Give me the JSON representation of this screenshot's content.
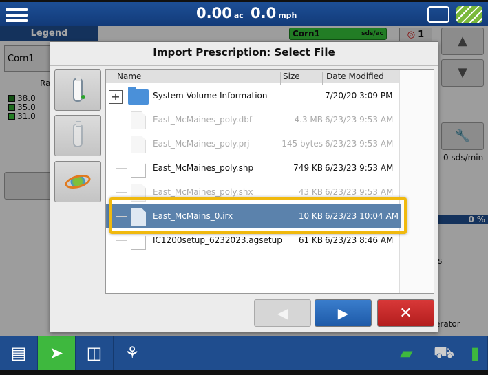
{
  "topbar": {
    "area_value": "0.00",
    "area_unit": "ac",
    "speed_value": "0.0",
    "speed_unit": "mph"
  },
  "work": {
    "legend_tab": "Legend",
    "legend_product": "Corn1",
    "rate_label": "Ra",
    "legend_rows": [
      {
        "value": "38.0",
        "color": "#1e7d1e"
      },
      {
        "value": "35.0",
        "color": "#2ea52e"
      },
      {
        "value": "31.0",
        "color": "#3ac23a"
      }
    ],
    "product_tab_name": "Corn1",
    "product_tab_unit": "sds/ac",
    "counter": "1",
    "rate_value": "0 sds/min",
    "progress": "0 %",
    "side_text_1": "s",
    "side_text_2": "erator"
  },
  "dialog": {
    "title": "Import Prescription: Select File",
    "columns": {
      "name": "Name",
      "size": "Size",
      "date": "Date Modified"
    },
    "sources": [
      {
        "icon": "usb-drive-icon",
        "active": true
      },
      {
        "icon": "usb-drive-icon",
        "active": false
      },
      {
        "icon": "cloud-sync-icon",
        "active": true
      }
    ],
    "rows": [
      {
        "name": "System Volume Information",
        "size": "",
        "date": "7/20/20 3:09 PM",
        "type": "folder",
        "state": "normal"
      },
      {
        "name": "East_McMaines_poly.dbf",
        "size": "4.3 MB",
        "date": "6/23/23 9:53 AM",
        "type": "file",
        "state": "disabled"
      },
      {
        "name": "East_McMaines_poly.prj",
        "size": "145 bytes",
        "date": "6/23/23 9:53 AM",
        "type": "file",
        "state": "disabled"
      },
      {
        "name": "East_McMaines_poly.shp",
        "size": "749 KB",
        "date": "6/23/23 9:53 AM",
        "type": "file",
        "state": "normal"
      },
      {
        "name": "East_McMaines_poly.shx",
        "size": "43 KB",
        "date": "6/23/23 9:53 AM",
        "type": "file",
        "state": "disabled"
      },
      {
        "name": "East_McMains_0.irx",
        "size": "10 KB",
        "date": "6/23/23 10:04 AM",
        "type": "file",
        "state": "selected"
      },
      {
        "name": "IC1200setup_6232023.agsetup",
        "size": "61 KB",
        "date": "6/23/23 8:46 AM",
        "type": "file",
        "state": "normal"
      }
    ],
    "buttons": {
      "back": "◀",
      "next": "▶",
      "close": "✕"
    },
    "highlight_color": "#f0b90e"
  },
  "colors": {
    "brand_blue": "#1f4d8e",
    "active_green": "#3eb83e",
    "selected_row": "#5b82ac"
  },
  "bottombar": {
    "items": [
      "document-icon",
      "navigation-icon",
      "split-view-icon",
      "planter-icon",
      "field-icon",
      "tractor-icon",
      "implement-icon"
    ]
  }
}
